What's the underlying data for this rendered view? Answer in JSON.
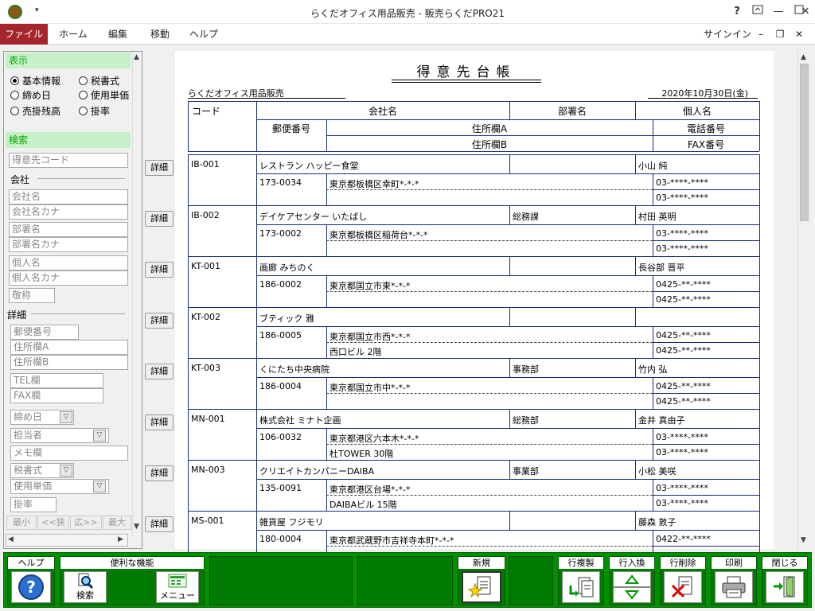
{
  "window": {
    "title": "らくだオフィス用品販売 - 販売らくだPRO21",
    "help": "?",
    "signin": "サインイン"
  },
  "menu": [
    "ファイル",
    "ホーム",
    "編集",
    "移動",
    "ヘルプ"
  ],
  "left": {
    "display_header": "表示",
    "radios": [
      {
        "label": "基本情報",
        "checked": true
      },
      {
        "label": "税書式",
        "checked": false
      },
      {
        "label": "締め日",
        "checked": false
      },
      {
        "label": "使用単価",
        "checked": false
      },
      {
        "label": "売掛残高",
        "checked": false
      },
      {
        "label": "掛率",
        "checked": false
      }
    ],
    "search_header": "検索",
    "fields": {
      "customer_code": "得意先コード",
      "company_label": "会社",
      "company_name": "会社名",
      "company_kana": "会社名カナ",
      "dept": "部署名",
      "dept_kana": "部署名カナ",
      "person": "個人名",
      "person_kana": "個人名カナ",
      "honorific": "敬称",
      "detail_label": "詳細",
      "postal": "郵便番号",
      "addr_a": "住所欄A",
      "addr_b": "住所欄B",
      "tel": "TEL欄",
      "fax": "FAX欄",
      "closing": "締め日",
      "staff": "担当者",
      "memo": "メモ欄",
      "tax": "税書式",
      "unit_price": "使用単価",
      "rate": "掛率"
    },
    "nav": [
      "最小",
      "<<狭",
      "広>>",
      "最大"
    ]
  },
  "report": {
    "title": "得意先台帳",
    "company": "らくだオフィス用品販売",
    "date": "2020年10月30日(金)",
    "headers": {
      "code": "コード",
      "company": "会社名",
      "dept": "部署名",
      "person": "個人名",
      "postal": "郵便番号",
      "addr_a": "住所欄A",
      "addr_b": "住所欄B",
      "tel": "電話番号",
      "fax": "FAX番号"
    },
    "detail_label": "詳細",
    "rows": [
      {
        "code": "IB-001",
        "company": "レストラン ハッピー食堂",
        "dept": "",
        "person": "小山 純",
        "postal": "173-0034",
        "addr_a": "東京都板橋区幸町*-*-*",
        "addr_b": "",
        "tel": "03-****-****",
        "fax": "03-****-****"
      },
      {
        "code": "IB-002",
        "company": "デイケアセンター いたばし",
        "dept": "総務課",
        "person": "村田 英明",
        "postal": "173-0002",
        "addr_a": "東京都板橋区稲荷台*-*-*",
        "addr_b": "",
        "tel": "03-****-****",
        "fax": "03-****-****"
      },
      {
        "code": "KT-001",
        "company": "画廊 みちのく",
        "dept": "",
        "person": "長谷部 晋平",
        "postal": "186-0002",
        "addr_a": "東京都国立市東*-*-*",
        "addr_b": "",
        "tel": "0425-**-****",
        "fax": "0425-**-****"
      },
      {
        "code": "KT-002",
        "company": "ブティック 雅",
        "dept": "",
        "person": "",
        "postal": "186-0005",
        "addr_a": "東京都国立市西*-*-*",
        "addr_b": "西口ビル 2階",
        "tel": "0425-**-****",
        "fax": "0425-**-****"
      },
      {
        "code": "KT-003",
        "company": "くにたち中央病院",
        "dept": "事務部",
        "person": "竹内 弘",
        "postal": "186-0004",
        "addr_a": "東京都国立市中*-*-*",
        "addr_b": "",
        "tel": "0425-**-****",
        "fax": "0425-**-****"
      },
      {
        "code": "MN-001",
        "company": "株式会社 ミナト企画",
        "dept": "総務部",
        "person": "金井 真由子",
        "postal": "106-0032",
        "addr_a": "東京都港区六本木*-*-*",
        "addr_b": "杜TOWER 30階",
        "tel": "03-****-****",
        "fax": "03-****-****"
      },
      {
        "code": "MN-003",
        "company": "クリエイトカンパニーDAIBA",
        "dept": "事業部",
        "person": "小松 美咲",
        "postal": "135-0091",
        "addr_a": "東京都港区台場*-*-*",
        "addr_b": "DAIBAビル 15階",
        "tel": "03-****-****",
        "fax": "03-****-****"
      },
      {
        "code": "MS-001",
        "company": "雑貨屋 フジモリ",
        "dept": "",
        "person": "藤森 敦子",
        "postal": "180-0004",
        "addr_a": "東京都武蔵野市吉祥寺本町*-*-*",
        "addr_b": "",
        "tel": "0422-**-****",
        "fax": ""
      }
    ]
  },
  "toolbar": {
    "help_group": "ヘルプ",
    "convenient_group": "便利な機能",
    "search": "検索",
    "menu": "メニュー",
    "new_group": "新規",
    "copy_row": "行複製",
    "swap_row": "行入換",
    "delete_row": "行削除",
    "print": "印刷",
    "close": "閉じる"
  },
  "colors": {
    "toolbar_green": "#009000",
    "file_red": "#a4262c",
    "section_green": "#c8f0c8",
    "table_line": "#1a2a7a"
  }
}
